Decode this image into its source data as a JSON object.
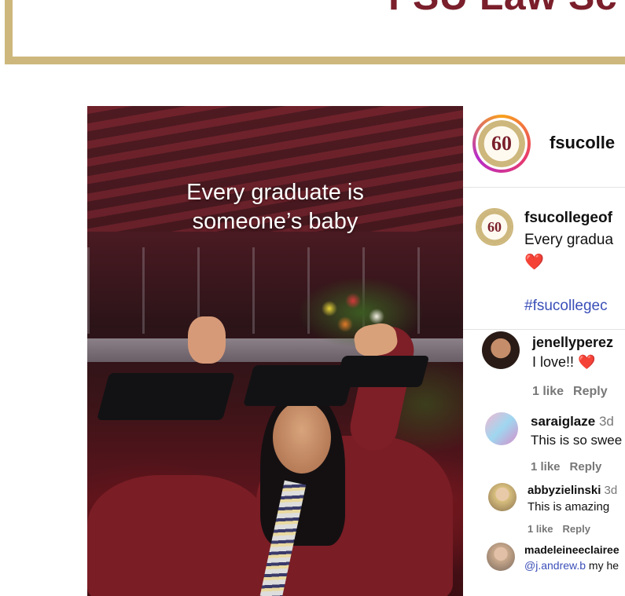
{
  "banner": {
    "title": "FSU Law Sc"
  },
  "post": {
    "image_text_line1": "Every graduate is",
    "image_text_line2": "someone’s baby",
    "account": {
      "username": "fsucolle",
      "logo_text": "60"
    },
    "caption": {
      "username": "fsucollegeof",
      "text": "Every gradua",
      "emoji": "❤️",
      "hashtag": "#fsucollegec"
    },
    "comments": [
      {
        "username": "jenellyperez",
        "time": "",
        "text": "I love!!",
        "emoji": "❤️",
        "likes": "1 like",
        "reply": "Reply"
      },
      {
        "username": "saraiglaze",
        "time": "3d",
        "text": "This is so swee",
        "likes": "1 like",
        "reply": "Reply"
      },
      {
        "username": "abbyzielinski",
        "time": "3d",
        "text": "This is amazing",
        "likes": "1 like",
        "reply": "Reply"
      },
      {
        "username": "madeleineeclairee",
        "mention": "@j.andrew.b",
        "text": " my he"
      }
    ]
  },
  "colors": {
    "banner_border": "#cdb77c",
    "banner_title": "#7a1f2b",
    "link": "#3b4fb8",
    "heart": "#e5253a"
  }
}
